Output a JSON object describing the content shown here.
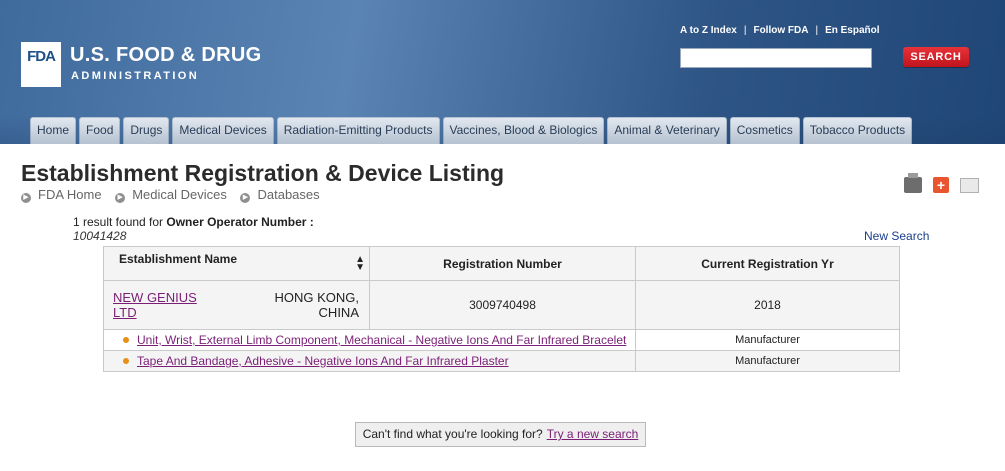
{
  "header": {
    "logo_box": "FDA",
    "logo_name": "U.S. FOOD & DRUG",
    "logo_sub": "ADMINISTRATION",
    "top_links": [
      "A to Z Index",
      "Follow FDA",
      "En Español"
    ],
    "search_placeholder": "",
    "search_button": "SEARCH"
  },
  "tabs": [
    "Home",
    "Food",
    "Drugs",
    "Medical Devices",
    "Radiation-Emitting Products",
    "Vaccines, Blood & Biologics",
    "Animal & Veterinary",
    "Cosmetics",
    "Tobacco Products"
  ],
  "page": {
    "title": "Establishment Registration & Device Listing",
    "breadcrumb": [
      "FDA Home",
      "Medical Devices",
      "Databases"
    ]
  },
  "results": {
    "summary_prefix": "1 result found for ",
    "summary_label": "Owner Operator Number :",
    "summary_value": "10041428",
    "new_search": "New Search"
  },
  "table": {
    "headers": {
      "establishment": "Establishment Name",
      "registration": "Registration Number",
      "current": "Current Registration Yr"
    },
    "row": {
      "name": "NEW GENIUS LTD",
      "location": "HONG KONG, CHINA",
      "registration_number": "3009740498",
      "current_year": "2018"
    },
    "devices": [
      {
        "name": "Unit, Wrist, External Limb Component, Mechanical - Negative Ions And Far Infrared Bracelet",
        "role": "Manufacturer"
      },
      {
        "name": "Tape And Bandage, Adhesive - Negative Ions And Far Infrared Plaster",
        "role": "Manufacturer"
      }
    ]
  },
  "footer": {
    "cant_find": "Can't find what you're looking for?",
    "try_link": "Try a new search"
  },
  "colors": {
    "header_blue": "#2e5585",
    "search_red": "#d01f27",
    "link_purple": "#7b1f76",
    "bullet_orange": "#e79019"
  }
}
